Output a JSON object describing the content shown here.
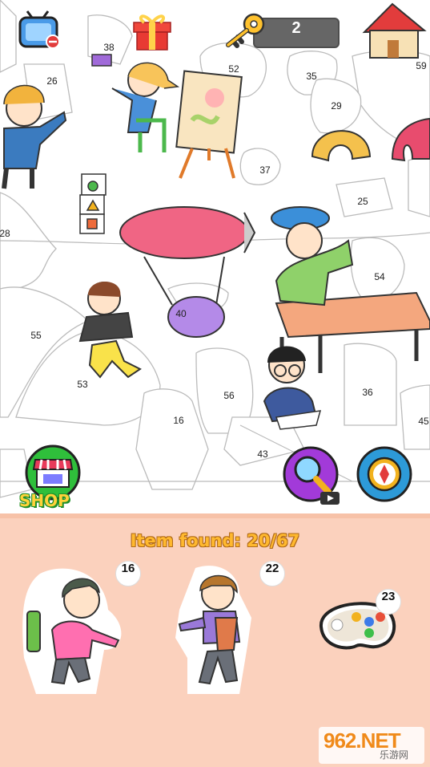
{
  "scene": {
    "numbers": [
      "38",
      "26",
      "52",
      "35",
      "59",
      "29",
      "37",
      "25",
      "28",
      "54",
      "40",
      "55",
      "53",
      "56",
      "36",
      "16",
      "45",
      "43"
    ]
  },
  "hud": {
    "key_count": "2"
  },
  "shop": {
    "label": "SHOP"
  },
  "panel": {
    "found_label": "Item found: 20/67",
    "items": [
      {
        "number": "16"
      },
      {
        "number": "22"
      },
      {
        "number": "23"
      }
    ]
  },
  "watermark": {
    "brand": "962.NET",
    "sub": "乐游网"
  }
}
